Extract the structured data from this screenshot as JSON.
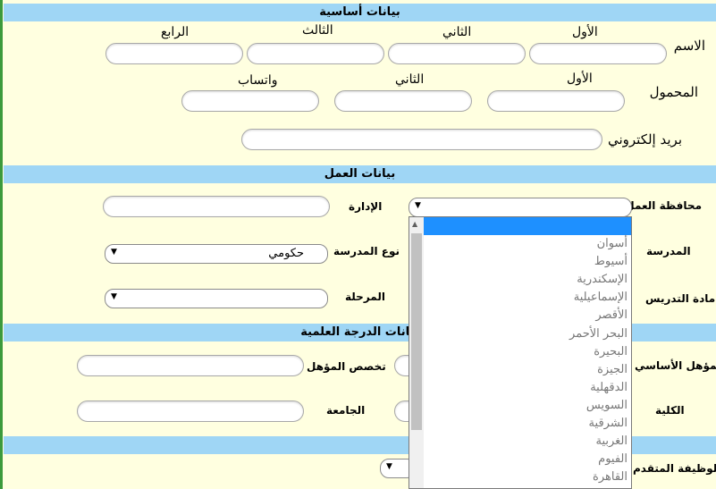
{
  "sections": {
    "basic": "بيانات أساسية",
    "work": "بيانات العمل",
    "degree": "بيانات الدرجة العلمية"
  },
  "basic": {
    "name_label": "الاسم",
    "name_parts": [
      "الأول",
      "الثاني",
      "الثالث",
      "الرابع"
    ],
    "mobile_label": "المحمول",
    "mobile_parts": [
      "الأول",
      "الثاني",
      "واتساب"
    ],
    "email_label": "بريد إلكتروني"
  },
  "work": {
    "governorate_label": "محافظة العمل",
    "administration_label": "الإدارة",
    "school_label": "المدرسة",
    "school_type_label": "نوع المدرسة",
    "school_type_value": "حكومي",
    "subject_label": "مادة التدريس",
    "stage_label": "المرحلة"
  },
  "degree": {
    "basic_qualification_label": "المؤهل الأساسي",
    "specialization_label": "تخصص المؤهل",
    "faculty_label": "الكلية",
    "university_label": "الجامعة"
  },
  "applied_job_label": "الوظيفة المتقدم",
  "governorate_options": [
    "",
    "أسوان",
    "أسيوط",
    "الإسكندرية",
    "الإسماعيلية",
    "الأقصر",
    "البحر الأحمر",
    "البحيرة",
    "الجيزة",
    "الدقهلية",
    "السويس",
    "الشرقية",
    "الغربية",
    "الفيوم",
    "القاهرة"
  ]
}
